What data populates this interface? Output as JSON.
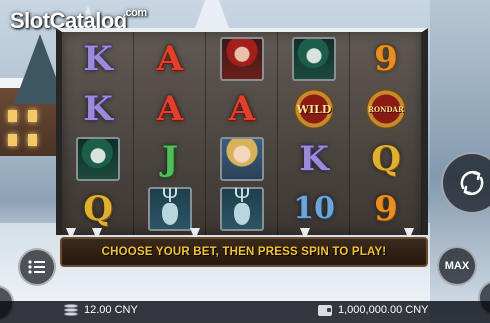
{
  "logo": {
    "text": "SlotCatalog",
    "suffix": ".com"
  },
  "reels": [
    [
      {
        "type": "letter",
        "class": "K",
        "label": "K"
      },
      {
        "type": "letter",
        "class": "K",
        "label": "K"
      },
      {
        "type": "portrait",
        "class": "green",
        "name": "green-hooded-heroine-symbol"
      },
      {
        "type": "letter",
        "class": "Q",
        "label": "Q"
      }
    ],
    [
      {
        "type": "letter",
        "class": "A",
        "label": "A"
      },
      {
        "type": "letter",
        "class": "A",
        "label": "A"
      },
      {
        "type": "letter",
        "class": "J",
        "label": "J"
      },
      {
        "type": "deer",
        "name": "stag-symbol"
      }
    ],
    [
      {
        "type": "portrait",
        "class": "red",
        "name": "red-hooded-heroine-symbol"
      },
      {
        "type": "letter",
        "class": "A",
        "label": "A"
      },
      {
        "type": "portrait",
        "class": "blonde",
        "name": "blonde-heroine-symbol"
      },
      {
        "type": "deer",
        "name": "stag-symbol"
      }
    ],
    [
      {
        "type": "portrait",
        "class": "green",
        "name": "green-hooded-heroine-symbol"
      },
      {
        "type": "medal",
        "class": "wild",
        "label": "WILD"
      },
      {
        "type": "letter",
        "class": "K",
        "label": "K"
      },
      {
        "type": "letter",
        "class": "N10",
        "label": "10"
      }
    ],
    [
      {
        "type": "letter",
        "class": "N9",
        "label": "9"
      },
      {
        "type": "medal",
        "class": "rondar",
        "label": "RONDAR"
      },
      {
        "type": "letter",
        "class": "Q",
        "label": "Q"
      },
      {
        "type": "letter",
        "class": "N9",
        "label": "9"
      }
    ]
  ],
  "message": "CHOOSE YOUR BET, THEN PRESS SPIN TO PLAY!",
  "controls": {
    "max_label": "MAX"
  },
  "bet": {
    "value": "12.00 CNY"
  },
  "balance": {
    "value": "1,000,000.00 CNY"
  },
  "colors": {
    "message_text": "#f3c233",
    "frame": "#3e3733"
  }
}
